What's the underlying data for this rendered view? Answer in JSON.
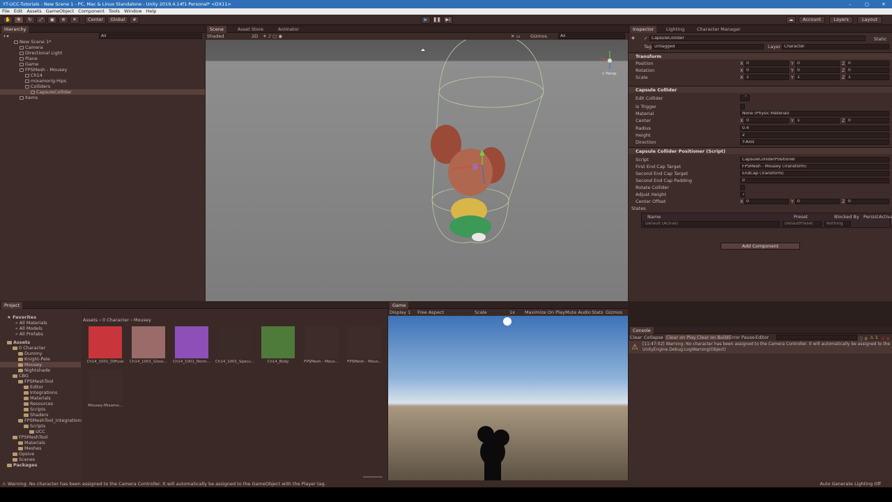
{
  "window": {
    "title": "YT-UCC-Tutorials - New Scene 1 - PC, Mac & Linux Standalone - Unity 2019.4.14f1 Personal* <DX11>"
  },
  "menu": [
    "File",
    "Edit",
    "Assets",
    "GameObject",
    "Component",
    "Tools",
    "Window",
    "Help"
  ],
  "toolbar": {
    "center": "Center",
    "global": "Global",
    "account": "Account",
    "layers": "Layers",
    "layout": "Layout"
  },
  "hierarchy": {
    "tab": "Hierarchy",
    "search_placeholder": "All",
    "items": [
      {
        "label": "New Scene 1*",
        "depth": 0
      },
      {
        "label": "Camera",
        "depth": 1
      },
      {
        "label": "Directional Light",
        "depth": 1
      },
      {
        "label": "Plane",
        "depth": 1
      },
      {
        "label": "Game",
        "depth": 1
      },
      {
        "label": "FPSMesh - Mousey",
        "depth": 1
      },
      {
        "label": "Ch14",
        "depth": 2
      },
      {
        "label": "mixamorig:Hips",
        "depth": 2
      },
      {
        "label": "Colliders",
        "depth": 2
      },
      {
        "label": "CapsuleCollider",
        "depth": 3
      },
      {
        "label": "Items",
        "depth": 1
      }
    ]
  },
  "scene": {
    "tabs": [
      "Scene",
      "Asset Store",
      "Animator"
    ],
    "shading": "Shaded",
    "mode2d": "2D",
    "gizmos": "Gizmos",
    "search": "All",
    "persp": "< Persp"
  },
  "inspector": {
    "tabs": [
      "Inspector",
      "Lighting",
      "Character Manager"
    ],
    "object_name": "CapsuleCollider",
    "static": "Static",
    "tag_label": "Tag",
    "tag": "Untagged",
    "layer_label": "Layer",
    "layer": "Character",
    "transform": {
      "title": "Transform",
      "rows": [
        {
          "label": "Position",
          "x": "0",
          "y": "0",
          "z": "0"
        },
        {
          "label": "Rotation",
          "x": "0",
          "y": "0",
          "z": "0"
        },
        {
          "label": "Scale",
          "x": "1",
          "y": "1",
          "z": "1"
        }
      ]
    },
    "capsule": {
      "title": "Capsule Collider",
      "edit_collider": "Edit Collider",
      "is_trigger": "Is Trigger",
      "material_label": "Material",
      "material": "None (Physic Material)",
      "center_label": "Center",
      "cx": "0",
      "cy": "1",
      "cz": "0",
      "radius_label": "Radius",
      "radius": "0.4",
      "height_label": "Height",
      "height": "2",
      "direction_label": "Direction",
      "direction": "Y-Axis"
    },
    "positioner": {
      "title": "Capsule Collider Positioner (Script)",
      "script_label": "Script",
      "script": "CapsuleColliderPositioner",
      "first_label": "First End Cap Target",
      "first": "FPSMesh - Mousey (Transform)",
      "second_label": "Second End Cap Target",
      "second": "EndCap (Transform)",
      "padding_label": "Second End Cap Padding",
      "padding": "0",
      "rotate_label": "Rotate Collider",
      "adjust_label": "Adjust Height",
      "offset_label": "Center Offset",
      "ox": "0",
      "oy": "0",
      "oz": "0",
      "states_label": "States",
      "states_cols": [
        "Name",
        "Preset",
        "Blocked By",
        "Persist",
        "Activate"
      ],
      "state_name": "Default (Active)",
      "state_preset": "DefaultPreset",
      "state_blocked": "Nothing"
    },
    "add_component": "Add Component"
  },
  "project": {
    "tab": "Project",
    "favorites": [
      "Favorites",
      "All Materials",
      "All Models",
      "All Prefabs"
    ],
    "tree": [
      {
        "label": "Assets",
        "depth": 0,
        "bold": true
      },
      {
        "label": "0 Character",
        "depth": 1
      },
      {
        "label": "Dummy",
        "depth": 2
      },
      {
        "label": "Knight-Pele",
        "depth": 2
      },
      {
        "label": "Mousey",
        "depth": 2,
        "sel": true
      },
      {
        "label": "Nightshade",
        "depth": 2
      },
      {
        "label": "CBG",
        "depth": 1
      },
      {
        "label": "FPSMeshTool",
        "depth": 2
      },
      {
        "label": "Editor",
        "depth": 3
      },
      {
        "label": "Integrations",
        "depth": 3
      },
      {
        "label": "Materials",
        "depth": 3
      },
      {
        "label": "Resources",
        "depth": 3
      },
      {
        "label": "Scripts",
        "depth": 3
      },
      {
        "label": "Shaders",
        "depth": 3
      },
      {
        "label": "FPSMeshTool_Integrations",
        "depth": 2
      },
      {
        "label": "Scripts",
        "depth": 3
      },
      {
        "label": "UCC",
        "depth": 4
      },
      {
        "label": "FPSMeshTool",
        "depth": 1
      },
      {
        "label": "Materials",
        "depth": 2
      },
      {
        "label": "Meshes",
        "depth": 2
      },
      {
        "label": "Opsive",
        "depth": 1
      },
      {
        "label": "Scenes",
        "depth": 1
      },
      {
        "label": "Packages",
        "depth": 0,
        "bold": true
      }
    ],
    "breadcrumb": [
      "Assets",
      "0 Character",
      "Mousey"
    ],
    "assets": [
      {
        "name": "Ch14_1001_Diffuse",
        "color": "#c8363b"
      },
      {
        "name": "Ch14_1001_Gloss...",
        "color": "#9a6b68"
      },
      {
        "name": "Ch14_1001_Norm...",
        "color": "#8e4fb8"
      },
      {
        "name": "Ch14_1001_Specu...",
        "color": "#3a2a28"
      },
      {
        "name": "Ch14_Body",
        "color": "#4e7a3a"
      },
      {
        "name": "FPSMesh - Mous...",
        "color": "#3d2c2a"
      },
      {
        "name": "FPSMesh - Mous...",
        "color": "#3d2c2a"
      },
      {
        "name": "Mousey-Mixamo...",
        "color": "#3d2c2a"
      }
    ]
  },
  "game": {
    "tab": "Game",
    "display": "Display 1",
    "aspect": "Free Aspect",
    "scale_label": "Scale",
    "scale": "1x",
    "buttons": [
      "Maximize On Play",
      "Mute Audio",
      "Stats",
      "Gizmos"
    ]
  },
  "console": {
    "tab": "Console",
    "buttons": [
      "Clear",
      "Collapse",
      "Clear on Play",
      "Clear on Build",
      "Error Pause",
      "Editor"
    ],
    "counts": {
      "info": "0",
      "warn": "1",
      "error": "0"
    },
    "message_line1": "[11:47:02] Warning: No character has been assigned to the Camera Controller. It will automatically be assigned to the GameObject with the Player tag.",
    "message_line2": "UnityEngine.Debug:LogWarning(Object)"
  },
  "status": {
    "message": "Warning: No character has been assigned to the Camera Controller. It will automatically be assigned to the GameObject with the Player tag.",
    "right": "Auto Generate Lighting Off"
  },
  "colors": {
    "accent": "#2e6fb8",
    "panel": "#3d2c2a",
    "warning": "#e8a34d"
  }
}
